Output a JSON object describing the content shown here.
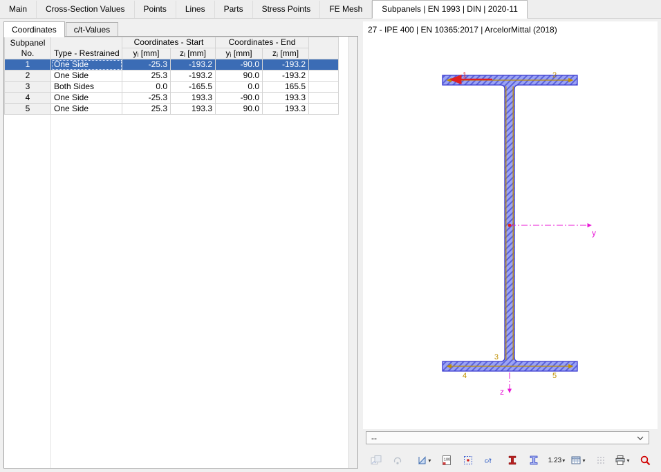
{
  "tabs": {
    "items": [
      "Main",
      "Cross-Section Values",
      "Points",
      "Lines",
      "Parts",
      "Stress Points",
      "FE Mesh",
      "Subpanels | EN 1993 | DIN | 2020-11"
    ],
    "active": 7
  },
  "subtabs": {
    "items": [
      "Coordinates",
      "c/t-Values"
    ],
    "active": 0
  },
  "table": {
    "col_subpanel_line1": "Subpanel",
    "col_subpanel_line2": "No.",
    "col_type": "Type - Restrained",
    "group_start": "Coordinates - Start",
    "group_end": "Coordinates - End",
    "col_yi": "yᵢ [mm]",
    "col_zi": "zᵢ [mm]",
    "col_yj": "yⱼ [mm]",
    "col_zj": "zⱼ [mm]",
    "rows": [
      {
        "no": "1",
        "type": "One Side",
        "yi": "-25.3",
        "zi": "-193.2",
        "yj": "-90.0",
        "zj": "-193.2",
        "selected": true
      },
      {
        "no": "2",
        "type": "One Side",
        "yi": "25.3",
        "zi": "-193.2",
        "yj": "90.0",
        "zj": "-193.2",
        "selected": false
      },
      {
        "no": "3",
        "type": "Both Sides",
        "yi": "0.0",
        "zi": "-165.5",
        "yj": "0.0",
        "zj": "165.5",
        "selected": false
      },
      {
        "no": "4",
        "type": "One Side",
        "yi": "-25.3",
        "zi": "193.3",
        "yj": "-90.0",
        "zj": "193.3",
        "selected": false
      },
      {
        "no": "5",
        "type": "One Side",
        "yi": "25.3",
        "zi": "193.3",
        "yj": "90.0",
        "zj": "193.3",
        "selected": false
      }
    ]
  },
  "preview": {
    "title": "27 - IPE 400 | EN 10365:2017 | ArcelorMittal (2018)",
    "subpanel_labels": [
      "1",
      "2",
      "3",
      "4",
      "5"
    ],
    "axis_y": "y",
    "axis_z": "z",
    "combo_value": "--"
  },
  "toolbar": {
    "decimal_label": "1.23",
    "scale_label": "100",
    "ct_label": "c/t"
  },
  "colors": {
    "selection": "#3b6cb5",
    "section_fill": "#9ba3f5",
    "section_hatch": "#5b63d8",
    "section_outline": "#3838d0",
    "midline": "#c09000",
    "axis": "#e816d6",
    "highlight_red": "#e02020"
  }
}
